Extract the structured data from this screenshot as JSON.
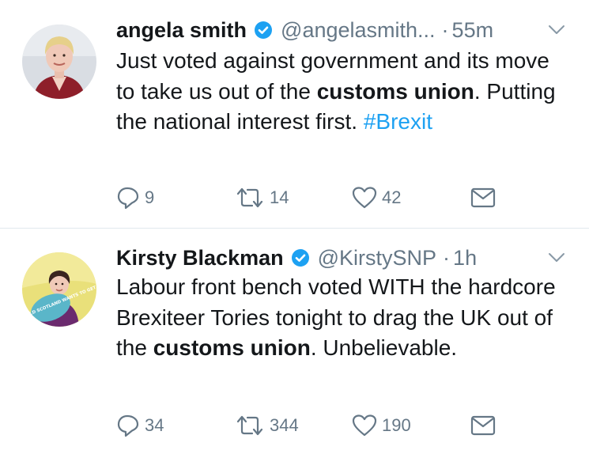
{
  "tweets": [
    {
      "name": "angela smith",
      "handle": "@angelasmith...",
      "dot": "·",
      "time": "55m",
      "text": {
        "p1": "Just voted against government and its move to take us out of the ",
        "b1": "customs union",
        "p2": ".  Putting the national interest first. ",
        "hashtag": "#Brexit"
      },
      "replies": "9",
      "retweets": "14",
      "likes": "42"
    },
    {
      "name": "Kirsty Blackman",
      "handle": "@KirstySNP",
      "dot": "·",
      "time": "1h",
      "text": {
        "p1": "Labour front bench voted WITH the hardcore Brexiteer Tories tonight to drag the UK out of the ",
        "b1": "customs union",
        "p2": ". Unbelievable."
      },
      "avatar_sign": "STOP THE WORLD SCOTLAND WANTS TO GET ON",
      "replies": "34",
      "retweets": "344",
      "likes": "190"
    }
  ],
  "icons": {
    "reply": "reply-icon",
    "retweet": "retweet-icon",
    "like": "heart-icon",
    "dm": "envelope-icon",
    "verified": "verified-badge-icon",
    "caret": "chevron-down-icon"
  },
  "colors": {
    "verified": "#1da1f2",
    "hashtag": "#1da1f2",
    "meta": "#657786",
    "divider": "#e1e8ed"
  }
}
